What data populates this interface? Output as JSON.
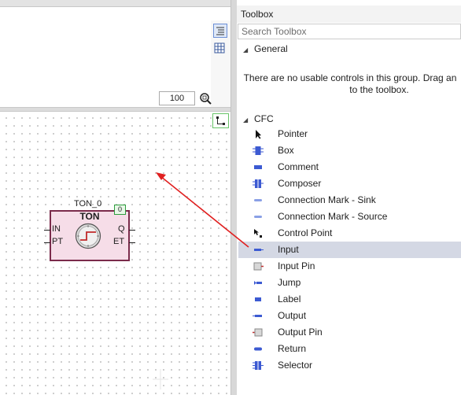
{
  "editor": {
    "zoom_value": "100",
    "block": {
      "instance_name": "TON_0",
      "type_name": "TON",
      "order_badge": "0",
      "inputs": [
        "IN",
        "PT"
      ],
      "outputs": [
        "Q",
        "ET"
      ]
    }
  },
  "toolbox": {
    "title": "Toolbox",
    "search_placeholder": "Search Toolbox",
    "groups": [
      {
        "name": "General",
        "empty_message_line1": "There are no usable controls in this group. Drag an",
        "empty_message_line2": "to the toolbox."
      },
      {
        "name": "CFC"
      }
    ],
    "items": [
      {
        "label": "Pointer",
        "icon": "pointer-icon"
      },
      {
        "label": "Box",
        "icon": "box-icon"
      },
      {
        "label": "Comment",
        "icon": "comment-icon"
      },
      {
        "label": "Composer",
        "icon": "composer-icon"
      },
      {
        "label": "Connection Mark - Sink",
        "icon": "connection-mark-sink-icon"
      },
      {
        "label": "Connection Mark - Source",
        "icon": "connection-mark-source-icon"
      },
      {
        "label": "Control Point",
        "icon": "control-point-icon"
      },
      {
        "label": "Input",
        "icon": "input-icon",
        "selected": true
      },
      {
        "label": "Input Pin",
        "icon": "input-pin-icon"
      },
      {
        "label": "Jump",
        "icon": "jump-icon"
      },
      {
        "label": "Label",
        "icon": "label-icon"
      },
      {
        "label": "Output",
        "icon": "output-icon"
      },
      {
        "label": "Output Pin",
        "icon": "output-pin-icon"
      },
      {
        "label": "Return",
        "icon": "return-icon"
      },
      {
        "label": "Selector",
        "icon": "selector-icon"
      }
    ]
  },
  "colors": {
    "selection": "#d4d8e4",
    "block_fill": "#f6dde8",
    "block_border": "#7b2b4b",
    "arrow": "#e02020",
    "icon_blue": "#3c5ad2"
  }
}
